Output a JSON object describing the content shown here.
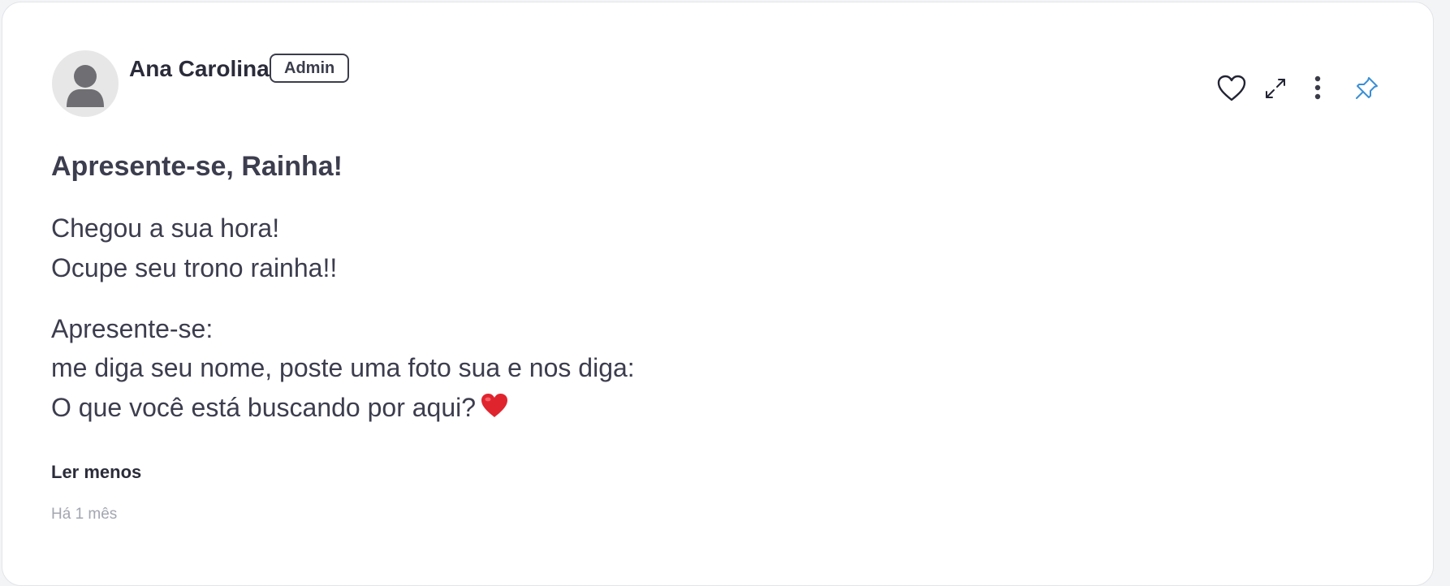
{
  "post": {
    "author": {
      "name": "Ana Carolina",
      "role_badge": "Admin",
      "avatar": "default-user-avatar"
    },
    "actions": {
      "like_icon": "heart-outline-icon",
      "expand_icon": "expand-arrows-icon",
      "more_icon": "more-vertical-icon",
      "pin_icon": "pin-icon",
      "pin_color": "#3b8fd6"
    },
    "title": "Apresente-se, Rainha!",
    "body": {
      "line_1": "Chegou a sua hora!",
      "line_2": "Ocupe seu trono rainha!!",
      "line_3": "Apresente-se:",
      "line_4": "me diga seu nome, poste uma foto sua e nos diga:",
      "line_5": "O que você está buscando por aqui?",
      "line_5_emoji": "red-heart-emoji"
    },
    "read_less_label": "Ler menos",
    "timestamp": "Há 1 mês"
  }
}
